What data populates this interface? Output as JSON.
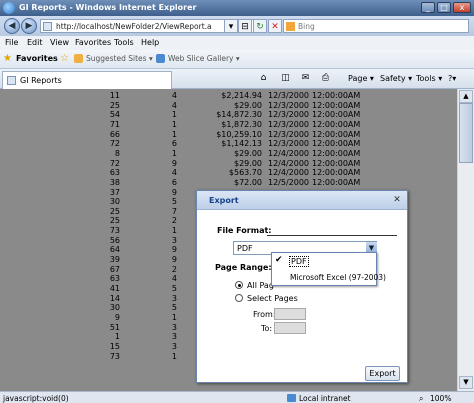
{
  "window": {
    "title": "GI Reports - Windows Internet Explorer"
  },
  "address": {
    "url": "http://localhost/NewFolder2/ViewReport.a",
    "search_placeholder": "Bing"
  },
  "menu": [
    "File",
    "Edit",
    "View",
    "Favorites",
    "Tools",
    "Help"
  ],
  "favorites": {
    "label": "Favorites",
    "suggested": "Suggested Sites ▾",
    "webslice": "Web Slice Gallery ▾"
  },
  "tab": {
    "label": "GI Reports"
  },
  "commands": {
    "page": "Page ▾",
    "safety": "Safety ▾",
    "tools": "Tools ▾",
    "help": "?▾"
  },
  "report_rows": [
    {
      "qty": "11",
      "count": "4",
      "amount": "$2,214.94",
      "date": "12/3/2000",
      "time": "12:00:00AM"
    },
    {
      "qty": "25",
      "count": "4",
      "amount": "$29.00",
      "date": "12/3/2000",
      "time": "12:00:00AM"
    },
    {
      "qty": "54",
      "count": "1",
      "amount": "$14,872.30",
      "date": "12/3/2000",
      "time": "12:00:00AM"
    },
    {
      "qty": "71",
      "count": "1",
      "amount": "$1,872.30",
      "date": "12/3/2000",
      "time": "12:00:00AM"
    },
    {
      "qty": "66",
      "count": "1",
      "amount": "$10,259.10",
      "date": "12/3/2000",
      "time": "12:00:00AM"
    },
    {
      "qty": "72",
      "count": "6",
      "amount": "$1,142.13",
      "date": "12/3/2000",
      "time": "12:00:00AM"
    },
    {
      "qty": "8",
      "count": "1",
      "amount": "$29.00",
      "date": "12/4/2000",
      "time": "12:00:00AM"
    },
    {
      "qty": "72",
      "count": "9",
      "amount": "$29.00",
      "date": "12/4/2000",
      "time": "12:00:00AM"
    },
    {
      "qty": "63",
      "count": "4",
      "amount": "$563.70",
      "date": "12/4/2000",
      "time": "12:00:00AM"
    },
    {
      "qty": "38",
      "count": "6",
      "amount": "$72.00",
      "date": "12/5/2000",
      "time": "12:00:00AM"
    },
    {
      "qty": "37",
      "count": "9",
      "amount": "",
      "date": "",
      "time": ""
    },
    {
      "qty": "30",
      "count": "5",
      "amount": "",
      "date": "",
      "time": ""
    },
    {
      "qty": "25",
      "count": "7",
      "amount": "",
      "date": "",
      "time": ""
    },
    {
      "qty": "25",
      "count": "2",
      "amount": "",
      "date": "",
      "time": ""
    },
    {
      "qty": "73",
      "count": "1",
      "amount": "",
      "date": "",
      "time": ""
    },
    {
      "qty": "56",
      "count": "3",
      "amount": "",
      "date": "",
      "time": ""
    },
    {
      "qty": "64",
      "count": "9",
      "amount": "",
      "date": "",
      "time": ""
    },
    {
      "qty": "39",
      "count": "9",
      "amount": "",
      "date": "",
      "time": ""
    },
    {
      "qty": "67",
      "count": "2",
      "amount": "",
      "date": "",
      "time": ""
    },
    {
      "qty": "63",
      "count": "4",
      "amount": "",
      "date": "",
      "time": ""
    },
    {
      "qty": "41",
      "count": "5",
      "amount": "",
      "date": "",
      "time": ""
    },
    {
      "qty": "14",
      "count": "3",
      "amount": "",
      "date": "",
      "time": ""
    },
    {
      "qty": "30",
      "count": "5",
      "amount": "",
      "date": "",
      "time": ""
    },
    {
      "qty": "9",
      "count": "1",
      "amount": "",
      "date": "",
      "time": ""
    },
    {
      "qty": "51",
      "count": "3",
      "amount": "",
      "date": "",
      "time": ""
    },
    {
      "qty": "1",
      "count": "3",
      "amount": "",
      "date": "",
      "time": ""
    },
    {
      "qty": "15",
      "count": "3",
      "amount": "",
      "date": "",
      "time": ""
    },
    {
      "qty": "73",
      "count": "1",
      "amount": "",
      "date": "",
      "time": ""
    }
  ],
  "dialog": {
    "title": "Export",
    "file_format_label": "File Format:",
    "format_value": "PDF",
    "page_range_label": "Page Range:",
    "all_pages": "All Pag",
    "select_pages": "Select Pages",
    "from_label": "From:",
    "to_label": "To:",
    "export_button": "Export",
    "options": [
      "PDF",
      "Microsoft Excel (97-2003)"
    ]
  },
  "status": {
    "text": "javascript:void(0)",
    "zone": "Local intranet",
    "zoom": "100%"
  }
}
